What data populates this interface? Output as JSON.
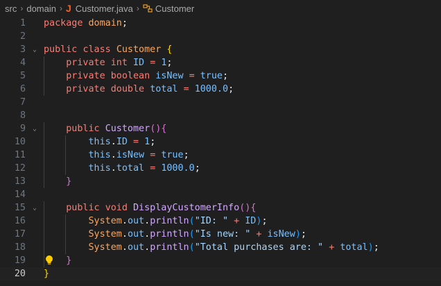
{
  "breadcrumbs": {
    "folder1": "src",
    "folder2": "domain",
    "file": "Customer.java",
    "file_icon_glyph": "J",
    "symbol": "Customer"
  },
  "editor": {
    "current_line": 20,
    "lines": [
      {
        "n": "1",
        "tokens": [
          [
            "k",
            "package"
          ],
          [
            "t",
            " "
          ],
          [
            "c",
            "domain"
          ],
          [
            "t",
            ";"
          ]
        ]
      },
      {
        "n": "2",
        "tokens": []
      },
      {
        "n": "3",
        "fold": true,
        "tokens": [
          [
            "k",
            "public"
          ],
          [
            "t",
            " "
          ],
          [
            "k",
            "class"
          ],
          [
            "t",
            " "
          ],
          [
            "c",
            "Customer"
          ],
          [
            "t",
            " "
          ],
          [
            "br1",
            "{"
          ]
        ]
      },
      {
        "n": "4",
        "tokens": [
          [
            "t",
            "    "
          ],
          [
            "k",
            "private"
          ],
          [
            "t",
            " "
          ],
          [
            "k",
            "int"
          ],
          [
            "t",
            " "
          ],
          [
            "n",
            "ID"
          ],
          [
            "t",
            " "
          ],
          [
            "k",
            "="
          ],
          [
            "t",
            " "
          ],
          [
            "n",
            "1"
          ],
          [
            "t",
            ";"
          ]
        ]
      },
      {
        "n": "5",
        "tokens": [
          [
            "t",
            "    "
          ],
          [
            "k",
            "private"
          ],
          [
            "t",
            " "
          ],
          [
            "k",
            "boolean"
          ],
          [
            "t",
            " "
          ],
          [
            "n",
            "isNew"
          ],
          [
            "t",
            " "
          ],
          [
            "k",
            "="
          ],
          [
            "t",
            " "
          ],
          [
            "n",
            "true"
          ],
          [
            "t",
            ";"
          ]
        ]
      },
      {
        "n": "6",
        "tokens": [
          [
            "t",
            "    "
          ],
          [
            "k",
            "private"
          ],
          [
            "t",
            " "
          ],
          [
            "k",
            "double"
          ],
          [
            "t",
            " "
          ],
          [
            "n",
            "total"
          ],
          [
            "t",
            " "
          ],
          [
            "k",
            "="
          ],
          [
            "t",
            " "
          ],
          [
            "n",
            "1000.0"
          ],
          [
            "t",
            ";"
          ]
        ]
      },
      {
        "n": "7",
        "tokens": []
      },
      {
        "n": "8",
        "tokens": []
      },
      {
        "n": "9",
        "fold": true,
        "tokens": [
          [
            "t",
            "    "
          ],
          [
            "k",
            "public"
          ],
          [
            "t",
            " "
          ],
          [
            "f",
            "Customer"
          ],
          [
            "br2",
            "()"
          ],
          [
            "br2",
            "{"
          ]
        ]
      },
      {
        "n": "10",
        "tokens": [
          [
            "t",
            "        "
          ],
          [
            "n",
            "this"
          ],
          [
            "t",
            "."
          ],
          [
            "n",
            "ID"
          ],
          [
            "t",
            " "
          ],
          [
            "k",
            "="
          ],
          [
            "t",
            " "
          ],
          [
            "n",
            "1"
          ],
          [
            "t",
            ";"
          ]
        ]
      },
      {
        "n": "11",
        "tokens": [
          [
            "t",
            "        "
          ],
          [
            "n",
            "this"
          ],
          [
            "t",
            "."
          ],
          [
            "n",
            "isNew"
          ],
          [
            "t",
            " "
          ],
          [
            "k",
            "="
          ],
          [
            "t",
            " "
          ],
          [
            "n",
            "true"
          ],
          [
            "t",
            ";"
          ]
        ]
      },
      {
        "n": "12",
        "tokens": [
          [
            "t",
            "        "
          ],
          [
            "n",
            "this"
          ],
          [
            "t",
            "."
          ],
          [
            "n",
            "total"
          ],
          [
            "t",
            " "
          ],
          [
            "k",
            "="
          ],
          [
            "t",
            " "
          ],
          [
            "n",
            "1000.0"
          ],
          [
            "t",
            ";"
          ]
        ]
      },
      {
        "n": "13",
        "tokens": [
          [
            "t",
            "    "
          ],
          [
            "br2",
            "}"
          ]
        ]
      },
      {
        "n": "14",
        "tokens": []
      },
      {
        "n": "15",
        "fold": true,
        "tokens": [
          [
            "t",
            "    "
          ],
          [
            "k",
            "public"
          ],
          [
            "t",
            " "
          ],
          [
            "k",
            "void"
          ],
          [
            "t",
            " "
          ],
          [
            "f",
            "DisplayCustomerInfo"
          ],
          [
            "br2",
            "()"
          ],
          [
            "br2",
            "{"
          ]
        ]
      },
      {
        "n": "16",
        "tokens": [
          [
            "t",
            "        "
          ],
          [
            "c",
            "System"
          ],
          [
            "t",
            "."
          ],
          [
            "n",
            "out"
          ],
          [
            "t",
            "."
          ],
          [
            "f",
            "println"
          ],
          [
            "br3",
            "("
          ],
          [
            "s",
            "\"ID: \""
          ],
          [
            "t",
            " "
          ],
          [
            "k",
            "+"
          ],
          [
            "t",
            " "
          ],
          [
            "n",
            "ID"
          ],
          [
            "br3",
            ")"
          ],
          [
            "t",
            ";"
          ]
        ]
      },
      {
        "n": "17",
        "tokens": [
          [
            "t",
            "        "
          ],
          [
            "c",
            "System"
          ],
          [
            "t",
            "."
          ],
          [
            "n",
            "out"
          ],
          [
            "t",
            "."
          ],
          [
            "f",
            "println"
          ],
          [
            "br3",
            "("
          ],
          [
            "s",
            "\"Is new: \""
          ],
          [
            "t",
            " "
          ],
          [
            "k",
            "+"
          ],
          [
            "t",
            " "
          ],
          [
            "n",
            "isNew"
          ],
          [
            "br3",
            ")"
          ],
          [
            "t",
            ";"
          ]
        ]
      },
      {
        "n": "18",
        "tokens": [
          [
            "t",
            "        "
          ],
          [
            "c",
            "System"
          ],
          [
            "t",
            "."
          ],
          [
            "n",
            "out"
          ],
          [
            "t",
            "."
          ],
          [
            "f",
            "println"
          ],
          [
            "br3",
            "("
          ],
          [
            "s",
            "\"Total purchases are: \""
          ],
          [
            "t",
            " "
          ],
          [
            "k",
            "+"
          ],
          [
            "t",
            " "
          ],
          [
            "n",
            "total"
          ],
          [
            "br3",
            ")"
          ],
          [
            "t",
            ";"
          ]
        ]
      },
      {
        "n": "19",
        "bulb": true,
        "tokens": [
          [
            "t",
            "    "
          ],
          [
            "br2",
            "}"
          ]
        ]
      },
      {
        "n": "20",
        "tokens": [
          [
            "br1",
            "}"
          ]
        ]
      }
    ]
  },
  "colors": {
    "background": "#1f1f1f",
    "keyword": "#ff7b72",
    "type": "#ffa657",
    "constant": "#79c0ff",
    "string": "#a5d6ff",
    "function": "#d2a8ff",
    "bracket_level1": "#ffd700",
    "bracket_level2": "#da70d6",
    "bracket_level3": "#179fff",
    "java_icon": "#f0642c",
    "lightbulb": "#ffcc00"
  },
  "icons": {
    "breadcrumb_separator": "chevron-right-icon",
    "file_icon": "java-file-icon",
    "symbol_icon": "symbol-class-icon",
    "fold_icon": "chevron-down-icon",
    "code_action": "lightbulb-icon"
  }
}
